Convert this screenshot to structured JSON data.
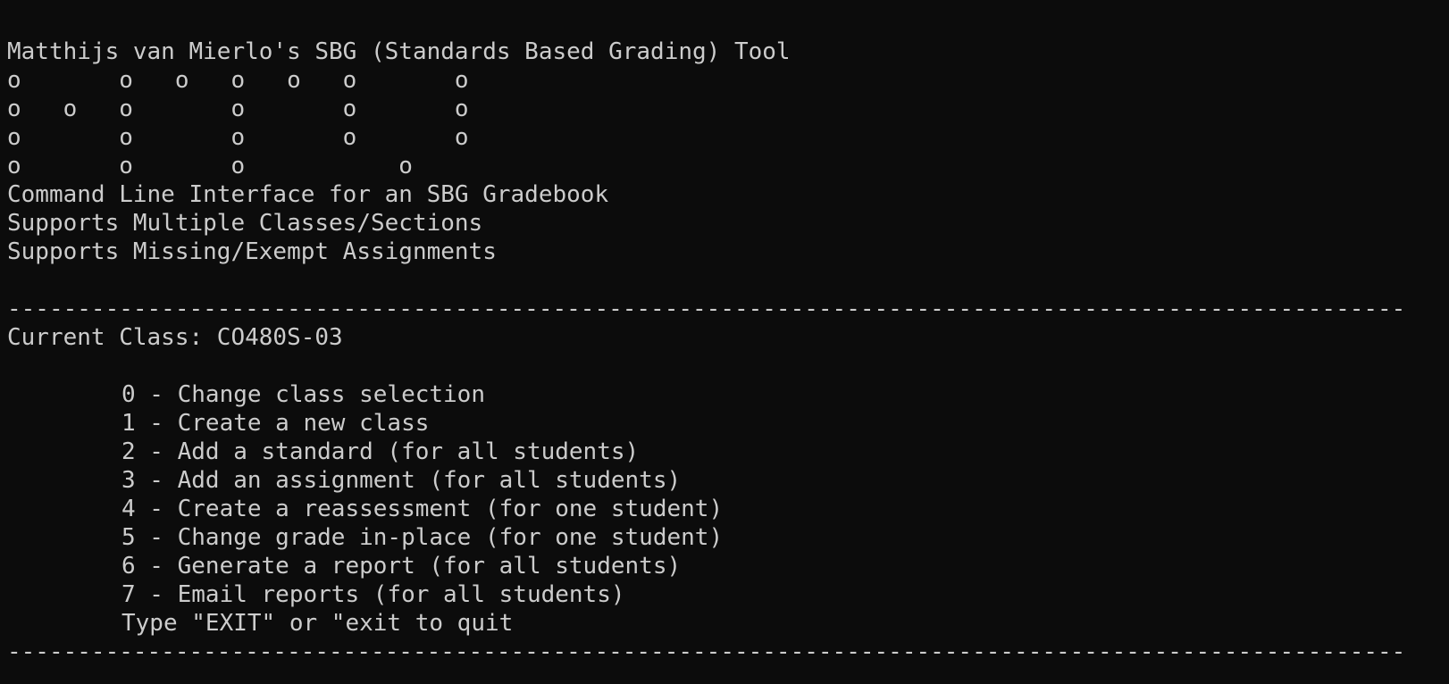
{
  "title": "Matthijs van Mierlo's SBG (Standards Based Grading) Tool",
  "ascii_art": [
    "o       o   o   o   o   o       o",
    "o   o   o       o       o       o",
    "o       o       o       o       o",
    "o       o       o           o"
  ],
  "description": [
    "Command Line Interface for an SBG Gradebook",
    "Supports Multiple Classes/Sections",
    "Supports Missing/Exempt Assignments"
  ],
  "separator": "----------------------------------------------------------------------------------------------------",
  "current_class": "Current Class: CO480S-03",
  "menu": [
    "0 - Change class selection",
    "1 - Create a new class",
    "2 - Add a standard (for all students)",
    "3 - Add an assignment (for all students)",
    "4 - Create a reassessment (for one student)",
    "5 - Change grade in-place (for one student)",
    "6 - Generate a report (for all students)",
    "7 - Email reports (for all students)"
  ],
  "exit_hint": "Type \"EXIT\" or \"exit to quit"
}
